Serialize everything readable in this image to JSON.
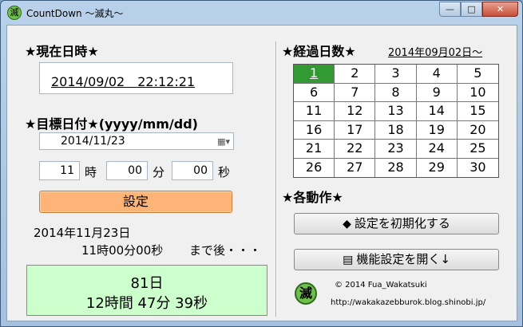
{
  "window": {
    "title": "CountDown ～滅丸～",
    "icon_glyph": "滅",
    "minimize": "—",
    "maximize": "□",
    "close": "✕"
  },
  "current": {
    "heading": "★現在日時★",
    "datetime": "2014/09/02　22:12:21"
  },
  "target": {
    "heading": "★目標日付★(yyyy/mm/dd)",
    "date": "2014/11/23",
    "calendar_icon": "calendar-dropdown-icon",
    "hour": "11",
    "hour_unit": "時",
    "minute": "00",
    "minute_unit": "分",
    "second": "00",
    "second_unit": "秒",
    "set_label": "設定"
  },
  "summary": {
    "date_line": "2014年11月23日",
    "time_line": "11時00分00秒",
    "suffix": "まで後・・・"
  },
  "remaining": {
    "days": "81日",
    "hms": "12時間 47分 39秒"
  },
  "elapsed": {
    "heading": "★経過日数★",
    "start_date": "2014年09月02日～",
    "days": [
      "1",
      "2",
      "3",
      "4",
      "5",
      "6",
      "7",
      "8",
      "9",
      "10",
      "11",
      "12",
      "13",
      "14",
      "15",
      "16",
      "17",
      "18",
      "19",
      "20",
      "21",
      "22",
      "23",
      "24",
      "25",
      "26",
      "27",
      "28",
      "29",
      "30"
    ],
    "active_day": "1"
  },
  "actions": {
    "heading": "★各動作★",
    "reset_label": "設定を初期化する",
    "reset_icon": "eraser-icon",
    "open_settings_label": "機能設定を開く↓",
    "open_settings_icon": "document-icon"
  },
  "footer": {
    "logo_glyph": "滅",
    "copyright": "© 2014 Fua_Wakatsuki",
    "url": "http://wakakazebburok.blog.shinobi.jp/"
  },
  "colors": {
    "set_button": "#ffb477",
    "remaining_panel": "#ccffcc",
    "active_day": "#339933"
  }
}
